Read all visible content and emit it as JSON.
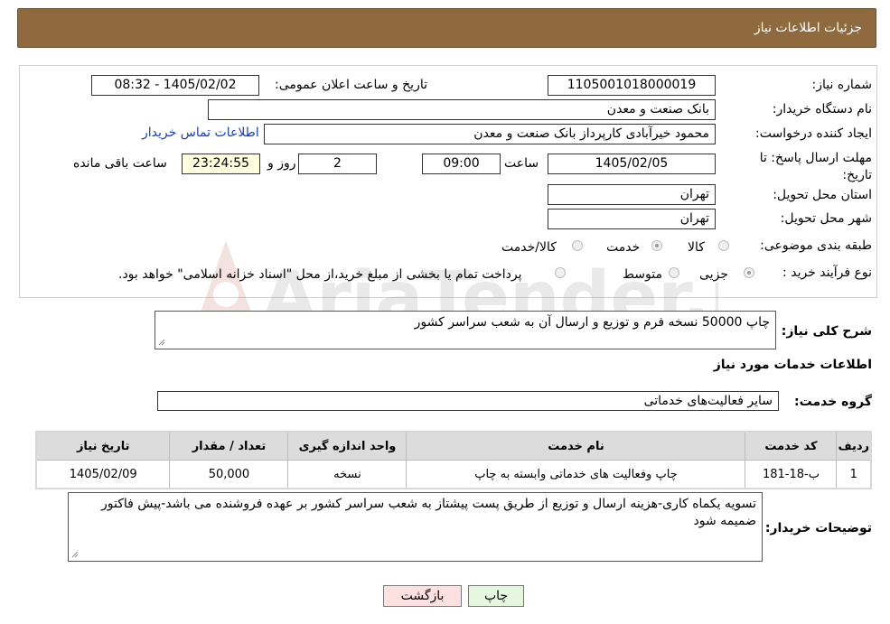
{
  "header": {
    "title": "جزئیات اطلاعات نیاز"
  },
  "form": {
    "need_number_label": "شماره نیاز:",
    "need_number": "1105001018000019",
    "announce_label": "تاریخ و ساعت اعلان عمومی:",
    "announce_value": "1405/02/02 - 08:32",
    "buyer_label": "نام دستگاه خریدار:",
    "buyer_value": "بانک صنعت و معدن",
    "creator_label": "ایجاد کننده درخواست:",
    "creator_value": "محمود خیرآبادی کارپرداز بانک صنعت و معدن",
    "contact_link": "اطلاعات تماس خریدار",
    "deadline_label": "مهلت ارسال پاسخ: تا تاریخ:",
    "deadline_date": "1405/02/05",
    "time_label": "ساعت",
    "deadline_time": "09:00",
    "days_value": "2",
    "days_label": "روز و",
    "remaining_value": "23:24:55",
    "remaining_label": "ساعت باقی مانده",
    "province_label": "استان محل تحویل:",
    "province_value": "تهران",
    "city_label": "شهر محل تحویل:",
    "city_value": "تهران",
    "category_label": "طبقه بندی موضوعی:",
    "category_options": [
      "کالا",
      "خدمت",
      "کالا/خدمت"
    ],
    "process_label": "نوع فرآیند خرید :",
    "process_options": [
      "جزیی",
      "متوسط"
    ],
    "process_note": "پرداخت تمام یا بخشی از مبلغ خرید،از محل \"اسناد خزانه اسلامی\" خواهد بود."
  },
  "summary": {
    "label": "شرح کلی نیاز:",
    "value": "چاپ 50000 نسخه فرم و توزیع و ارسال آن به شعب سراسر کشور"
  },
  "services": {
    "section_title": "اطلاعات خدمات مورد نیاز",
    "group_label": "گروه خدمت:",
    "group_value": "سایر فعالیت‌های خدماتی",
    "columns": [
      "ردیف",
      "کد خدمت",
      "نام خدمت",
      "واحد اندازه گیری",
      "تعداد / مقدار",
      "تاریخ نیاز"
    ],
    "rows": [
      [
        "1",
        "ب-18-181",
        "چاپ وفعالیت های خدماتی وابسته به چاپ",
        "نسخه",
        "50,000",
        "1405/02/09"
      ]
    ]
  },
  "notes": {
    "label": "توضیحات خریدار:",
    "value": "تسویه یکماه کاری-هزینه ارسال و توزیع از طریق پست پیشتاز به شعب سراسر کشور بر عهده فروشنده می باشد-پیش فاکتور ضمیمه شود"
  },
  "buttons": {
    "print": "چاپ",
    "back": "بازگشت"
  },
  "watermark": {
    "text": "AriaTender.neT"
  },
  "colors": {
    "header_bg": "#8f6a3e",
    "link": "#1a3fb0",
    "back_btn": "#fde0e0",
    "print_btn": "#e6f7e0"
  }
}
